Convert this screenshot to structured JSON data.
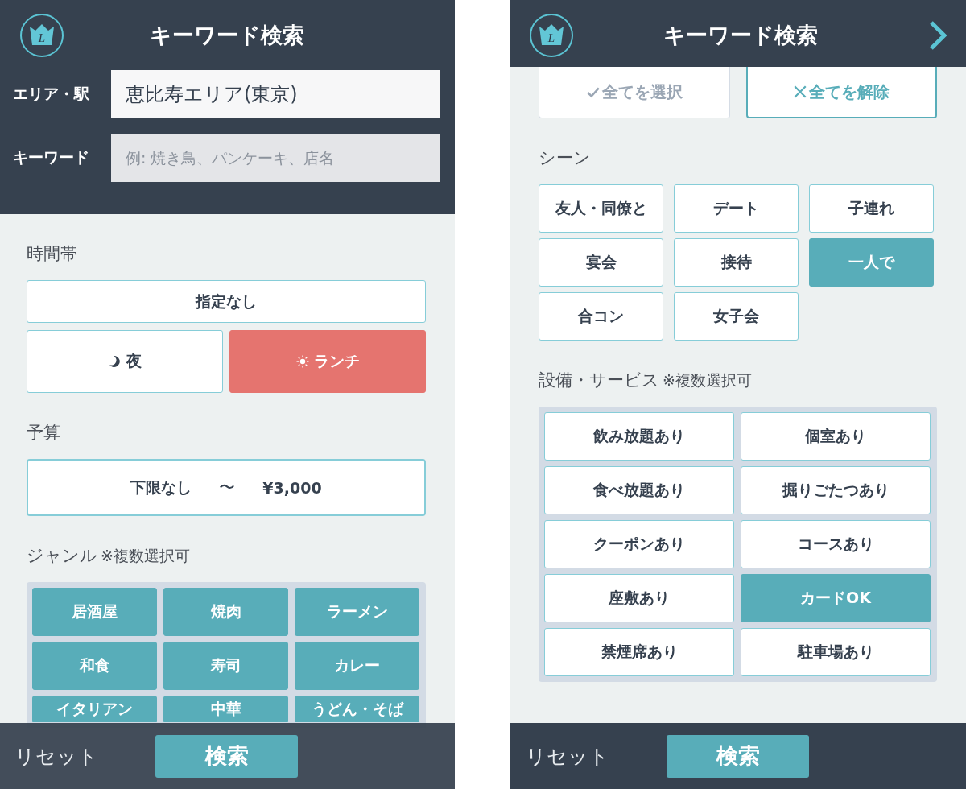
{
  "left_screen": {
    "header": {
      "logo_letter": "L",
      "title": "キーワード検索"
    },
    "area": {
      "label": "エリア・駅",
      "value": "恵比寿エリア(東京)"
    },
    "keyword": {
      "label": "キーワード",
      "placeholder": "例: 焼き鳥、パンケーキ、店名"
    },
    "time_slot": {
      "heading": "時間帯",
      "options": [
        {
          "kind": "any",
          "label": "指定なし",
          "selected": false
        },
        {
          "kind": "night",
          "label": "夜",
          "selected": false
        },
        {
          "kind": "lunch",
          "label": "ランチ",
          "selected": true
        }
      ]
    },
    "budget": {
      "heading": "予算",
      "min": "下限なし",
      "separator": "〜",
      "max": "¥3,000"
    },
    "genre": {
      "heading": "ジャンル",
      "note": "※複数選択可",
      "items": [
        {
          "label": "居酒屋",
          "selected": true
        },
        {
          "label": "焼肉",
          "selected": true
        },
        {
          "label": "ラーメン",
          "selected": true
        },
        {
          "label": "和食",
          "selected": true
        },
        {
          "label": "寿司",
          "selected": true
        },
        {
          "label": "カレー",
          "selected": true
        },
        {
          "label": "イタリアン",
          "selected": true
        },
        {
          "label": "中華",
          "selected": true
        },
        {
          "label": "うどん・そば",
          "selected": true
        }
      ]
    },
    "footer": {
      "reset": "リセット",
      "search": "検索"
    }
  },
  "right_screen": {
    "header": {
      "logo_letter": "L",
      "title": "キーワード検索"
    },
    "bulk": [
      {
        "kind": "select_all",
        "label": "全てを選択",
        "disabled": true
      },
      {
        "kind": "clear_all",
        "label": "全てを解除",
        "disabled": false
      }
    ],
    "scene": {
      "heading": "シーン",
      "items": [
        {
          "label": "友人・同僚と",
          "selected": false
        },
        {
          "label": "デート",
          "selected": false
        },
        {
          "label": "子連れ",
          "selected": false
        },
        {
          "label": "宴会",
          "selected": false
        },
        {
          "label": "接待",
          "selected": false
        },
        {
          "label": "一人で",
          "selected": true
        },
        {
          "label": "合コン",
          "selected": false
        },
        {
          "label": "女子会",
          "selected": false
        }
      ]
    },
    "facilities": {
      "heading": "設備・サービス",
      "note": "※複数選択可",
      "items": [
        {
          "label": "飲み放題あり",
          "selected": false
        },
        {
          "label": "個室あり",
          "selected": false
        },
        {
          "label": "食べ放題あり",
          "selected": false
        },
        {
          "label": "掘りごたつあり",
          "selected": false
        },
        {
          "label": "クーポンあり",
          "selected": false
        },
        {
          "label": "コースあり",
          "selected": false
        },
        {
          "label": "座敷あり",
          "selected": false
        },
        {
          "label": "カードOK",
          "selected": true
        },
        {
          "label": "禁煙席あり",
          "selected": false
        },
        {
          "label": "駐車場あり",
          "selected": false
        }
      ]
    },
    "footer": {
      "reset": "リセット",
      "search": "検索"
    }
  }
}
